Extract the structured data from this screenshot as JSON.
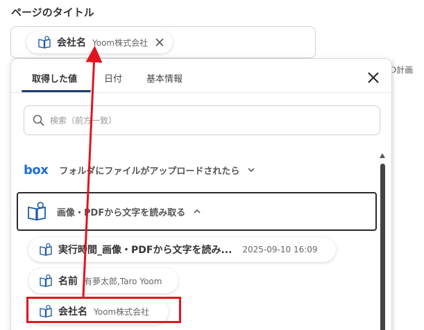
{
  "page_title_label": "ページのタイトル",
  "title_field": {
    "chip": {
      "title": "会社名",
      "value": "Yoom株式会社",
      "remove_icon": "close-icon"
    }
  },
  "behind_text": "D計画",
  "picker": {
    "tabs": [
      {
        "label": "取得した値",
        "active": true
      },
      {
        "label": "日付",
        "active": false
      },
      {
        "label": "基本情報",
        "active": false
      }
    ],
    "close_icon": "close-icon",
    "search": {
      "placeholder": "検索（前方一致）",
      "value": ""
    },
    "sections": [
      {
        "logo": "box",
        "label": "フォルダにファイルがアップロードされたら",
        "expanded": false
      },
      {
        "label": "画像・PDFから文字を読み取る",
        "expanded": true
      }
    ],
    "items": [
      {
        "title": "実行時間_画像・PDFから文字を読み...",
        "value": "2025-09-10 16:09"
      },
      {
        "title": "名前",
        "value": "有夢太郎,Taro Yoom"
      },
      {
        "title": "会社名",
        "value": "Yoom株式会社"
      }
    ]
  },
  "colors": {
    "accent": "#1d3a6e",
    "box_brand": "#1f6fd6",
    "annotation": "#e0151f"
  }
}
